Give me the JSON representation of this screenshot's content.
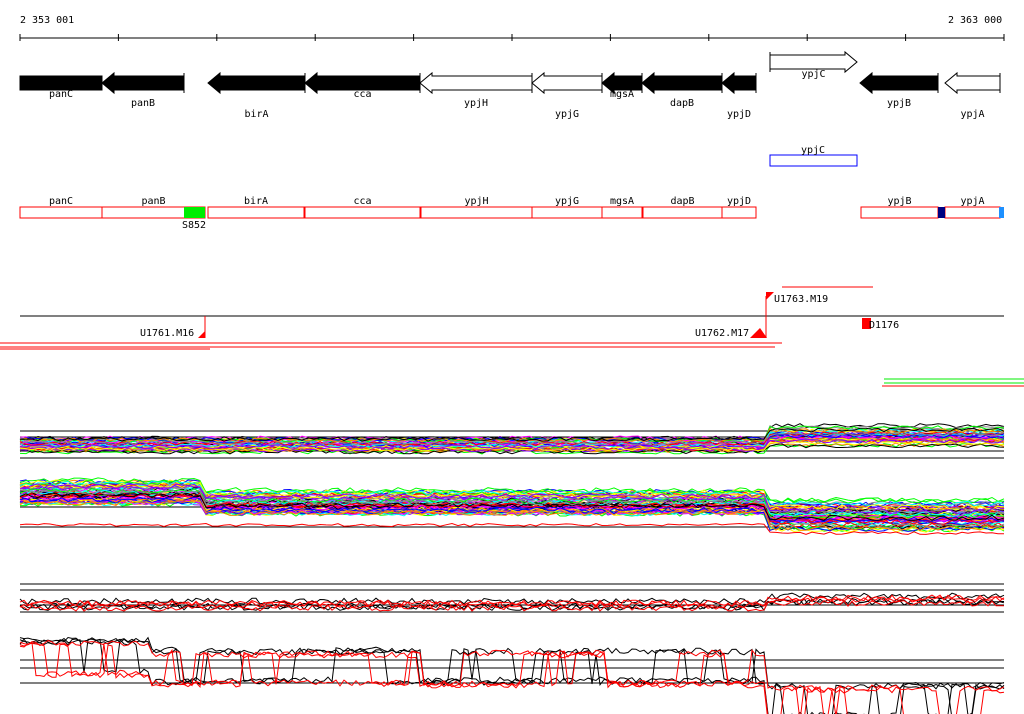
{
  "ruler": {
    "start_label": "2 353 001",
    "end_label": "2 363 000"
  },
  "genes": [
    {
      "name": "panC",
      "strand": "-",
      "filled": true
    },
    {
      "name": "panB",
      "strand": "-",
      "filled": true
    },
    {
      "name": "birA",
      "strand": "-",
      "filled": true
    },
    {
      "name": "cca",
      "strand": "-",
      "filled": true
    },
    {
      "name": "ypjH",
      "strand": "-",
      "filled": false
    },
    {
      "name": "ypjG",
      "strand": "-",
      "filled": false
    },
    {
      "name": "mgsA",
      "strand": "-",
      "filled": true
    },
    {
      "name": "dapB",
      "strand": "-",
      "filled": true
    },
    {
      "name": "ypjD",
      "strand": "-",
      "filled": true
    },
    {
      "name": "ypjC",
      "strand": "+",
      "filled": false
    },
    {
      "name": "ypjB",
      "strand": "-",
      "filled": true
    },
    {
      "name": "ypjA",
      "strand": "-",
      "filled": false
    }
  ],
  "plus_strand_box": {
    "name": "ypjC",
    "color": "#0000ff"
  },
  "annotation_boxes": [
    "panC",
    "panB",
    "birA",
    "cca",
    "ypjH",
    "ypjG",
    "mgsA",
    "dapB",
    "ypjD",
    "ypjB",
    "ypjA"
  ],
  "features": {
    "S852": {
      "label": "S852",
      "color": "#00ee00"
    }
  },
  "tss": {
    "u1761": "U1761.M16",
    "u1762": "U1762.M17",
    "u1763": "U1763.M19",
    "d1176": "D1176"
  },
  "colors": {
    "box": "#ff0000",
    "dark_blue": "#000080",
    "light_blue": "#1e90ff"
  }
}
